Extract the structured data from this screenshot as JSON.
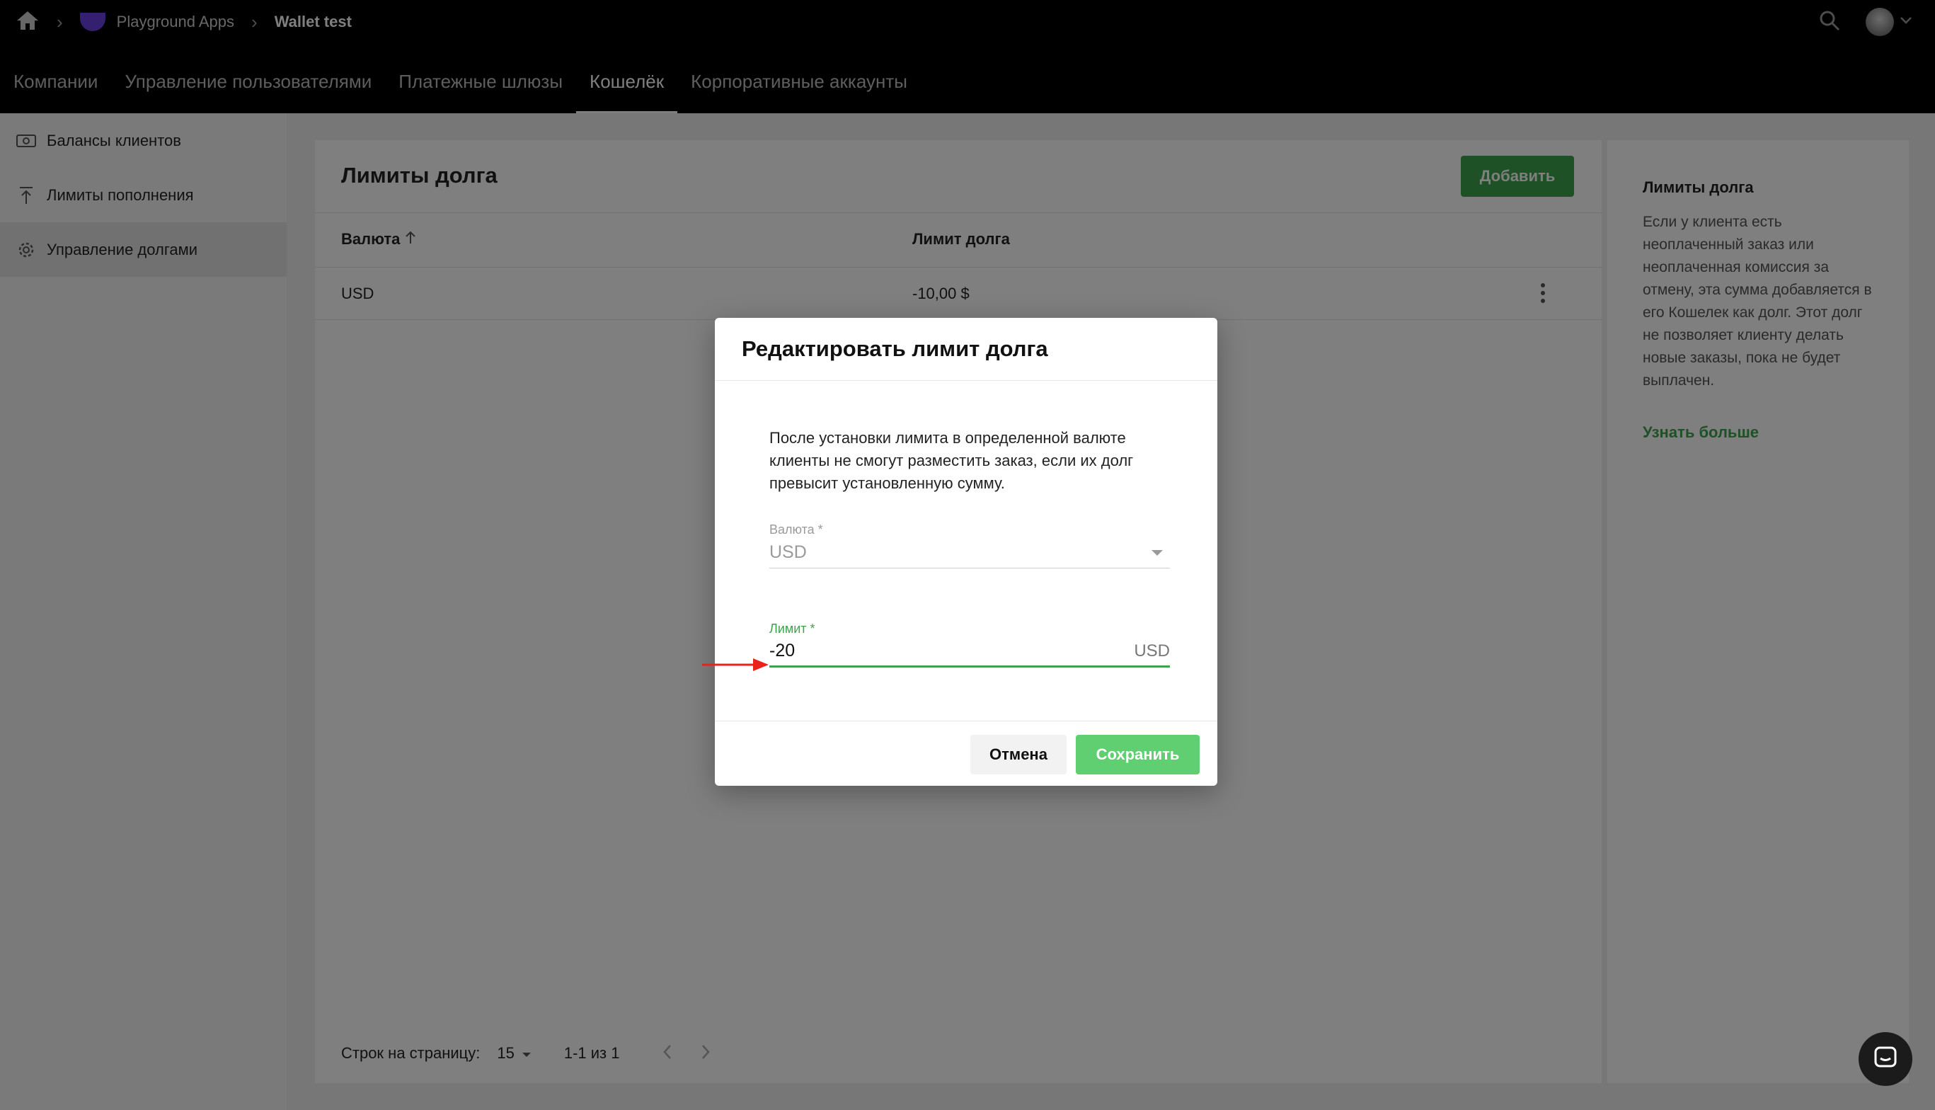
{
  "breadcrumbs": {
    "app": "Playground Apps",
    "current": "Wallet test"
  },
  "nav": {
    "tabs": [
      {
        "label": "Компании"
      },
      {
        "label": "Управление пользователями"
      },
      {
        "label": "Платежные шлюзы"
      },
      {
        "label": "Кошелёк",
        "active": true
      },
      {
        "label": "Корпоративные аккаунты"
      }
    ]
  },
  "sidebar": {
    "items": [
      {
        "label": "Балансы клиентов",
        "icon": "cash-icon"
      },
      {
        "label": "Лимиты пополнения",
        "icon": "upload-limit-icon"
      },
      {
        "label": "Управление долгами",
        "icon": "gear-icon",
        "active": true
      }
    ]
  },
  "card": {
    "title": "Лимиты долга",
    "add_label": "Добавить",
    "columns": [
      "Валюта",
      "Лимит долга"
    ],
    "rows": [
      {
        "currency": "USD",
        "limit": "-10,00 $"
      }
    ],
    "pager": {
      "rows_label": "Строк на страницу:",
      "rows_value": "15",
      "range": "1-1 из 1"
    }
  },
  "info": {
    "title": "Лимиты долга",
    "text": "Если у клиента есть неоплаченный заказ или неоплаченная комиссия за отмену, эта сумма добавляется в его Кошелек как долг. Этот долг не позволяет клиенту делать новые заказы, пока не будет выплачен.",
    "link": "Узнать больше"
  },
  "modal": {
    "title": "Редактировать лимит долга",
    "description": "После установки лимита в определенной валюте клиенты не смогут разместить заказ, если их долг превысит установленную сумму.",
    "currency_label": "Валюта *",
    "currency_value": "USD",
    "limit_label": "Лимит *",
    "limit_value": "-20",
    "limit_unit": "USD",
    "cancel_label": "Отмена",
    "save_label": "Сохранить"
  },
  "colors": {
    "accent": "#3fa34d",
    "save": "#5fcf71",
    "annotation": "#e8231a"
  }
}
